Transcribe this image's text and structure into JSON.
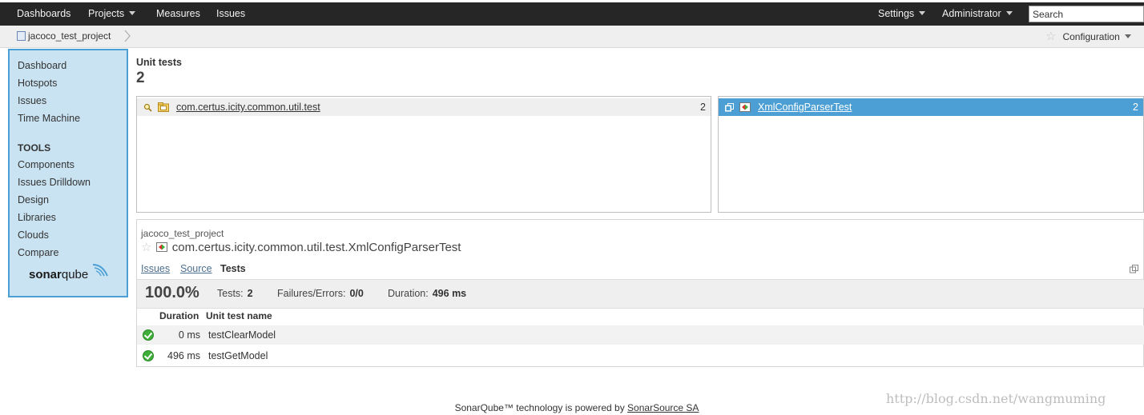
{
  "nav": {
    "dashboards": "Dashboards",
    "projects": "Projects",
    "measures": "Measures",
    "issues": "Issues",
    "settings": "Settings",
    "administrator": "Administrator",
    "search_placeholder": "Search"
  },
  "breadcrumb": {
    "project": "jacoco_test_project",
    "configuration": "Configuration"
  },
  "sidebar": {
    "items": [
      "Dashboard",
      "Hotspots",
      "Issues",
      "Time Machine"
    ],
    "tools_heading": "TOOLS",
    "tools": [
      "Components",
      "Issues Drilldown",
      "Design",
      "Libraries",
      "Clouds",
      "Compare"
    ],
    "logo_bold": "sonar",
    "logo_light": "qube"
  },
  "main": {
    "title": "Unit tests",
    "count": "2",
    "packages": [
      {
        "name": "com.certus.icity.common.util.test",
        "value": "2"
      }
    ],
    "files": [
      {
        "name": "XmlConfigParserTest",
        "value": "2"
      }
    ]
  },
  "detail": {
    "project": "jacoco_test_project",
    "name": "com.certus.icity.common.util.test.XmlConfigParserTest",
    "tabs": [
      "Issues",
      "Source",
      "Tests"
    ],
    "active_tab": "Tests",
    "success_rate": "100.0%",
    "tests_label": "Tests:",
    "tests_value": "2",
    "failures_label": "Failures/Errors:",
    "failures_value": "0/0",
    "duration_label": "Duration:",
    "duration_value": "496 ms",
    "col_duration": "Duration",
    "col_name": "Unit test name",
    "rows": [
      {
        "duration": "0 ms",
        "name": "testClearModel"
      },
      {
        "duration": "496 ms",
        "name": "testGetModel"
      }
    ]
  },
  "footer": {
    "text": "SonarQube™ technology is powered by",
    "link": "SonarSource SA"
  },
  "watermark": "http://blog.csdn.net/wangmuming",
  "colors": {
    "navbar": "#262626",
    "sidebar_bg": "#cae3f2",
    "sidebar_border": "#4b9fd5",
    "selected_row": "#4b9fd5",
    "success": "#3fae38"
  }
}
